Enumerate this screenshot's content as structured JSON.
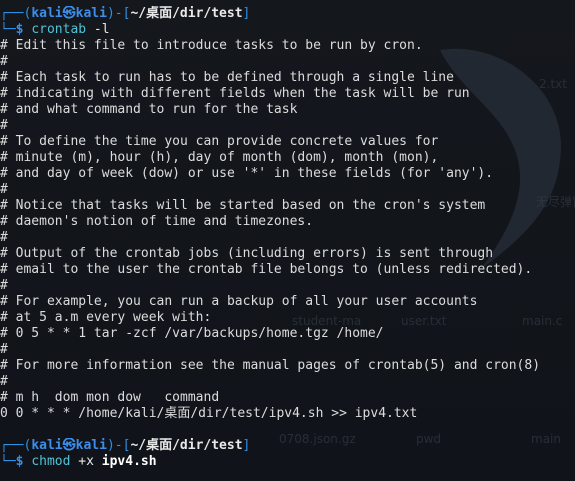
{
  "desktop": {
    "icons": [
      "2.txt",
      "无尽弹窗.sh",
      "student-ma",
      "user.txt",
      "main.c",
      "0708.json.gz",
      "pwd",
      "main"
    ]
  },
  "session1": {
    "user": "kali",
    "at": "㉿",
    "host": "kali",
    "cwd": "~/桌面/dir/test",
    "command": "crontab",
    "args": " -l"
  },
  "output": [
    "# Edit this file to introduce tasks to be run by cron.",
    "#",
    "# Each task to run has to be defined through a single line",
    "# indicating with different fields when the task will be run",
    "# and what command to run for the task",
    "#",
    "# To define the time you can provide concrete values for",
    "# minute (m), hour (h), day of month (dom), month (mon),",
    "# and day of week (dow) or use '*' in these fields (for 'any').",
    "#",
    "# Notice that tasks will be started based on the cron's system",
    "# daemon's notion of time and timezones.",
    "#",
    "# Output of the crontab jobs (including errors) is sent through",
    "# email to the user the crontab file belongs to (unless redirected).",
    "#",
    "# For example, you can run a backup of all your user accounts",
    "# at 5 a.m every week with:",
    "# 0 5 * * 1 tar -zcf /var/backups/home.tgz /home/",
    "#",
    "# For more information see the manual pages of crontab(5) and cron(8)",
    "#",
    "# m h  dom mon dow   command",
    "0 0 * * * /home/kali/桌面/dir/test/ipv4.sh >> ipv4.txt"
  ],
  "session2": {
    "user": "kali",
    "at": "㉿",
    "host": "kali",
    "cwd": "~/桌面/dir/test",
    "command": "chmod",
    "args": " +x ",
    "target": "ipv4.sh"
  }
}
